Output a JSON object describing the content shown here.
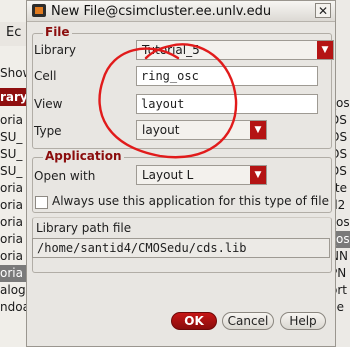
{
  "window": {
    "title": "New File@csimcluster.ee.unlv.edu",
    "close_glyph": "✕"
  },
  "background": {
    "menu_fragment": "Ec",
    "show_fragment": "Show",
    "library_fragment": "rary",
    "left_list": [
      "oria",
      "SU_",
      "SU_",
      "SU_",
      "oria",
      "oria",
      "oria",
      "oria",
      "oria",
      "oria",
      "alog",
      "ndoa"
    ],
    "left_selected_index": 9,
    "right_list": [
      "_os",
      "DS",
      "OS",
      "OS",
      "DS",
      "rte",
      "d2",
      "_os",
      "_os",
      "NN",
      "PN",
      "ort",
      "ile"
    ],
    "right_selected_index": 8
  },
  "file_group": {
    "legend": "File",
    "library_label": "Library",
    "library_value": "Tutorial_5",
    "cell_label": "Cell",
    "cell_value": "ring_osc",
    "view_label": "View",
    "view_value": "layout",
    "type_label": "Type",
    "type_value": "layout"
  },
  "application_group": {
    "legend": "Application",
    "open_with_label": "Open with",
    "open_with_value": "Layout L",
    "always_use_label": "Always use this application for this type of file"
  },
  "library_path": {
    "label": "Library path file",
    "value": "/home/santid4/CMOSedu/cds.lib"
  },
  "buttons": {
    "ok": "OK",
    "cancel": "Cancel",
    "help": "Help"
  },
  "colors": {
    "accent_red": "#b41414",
    "annotation_red": "#e11b1b",
    "legend_red": "#8b0d0d"
  }
}
